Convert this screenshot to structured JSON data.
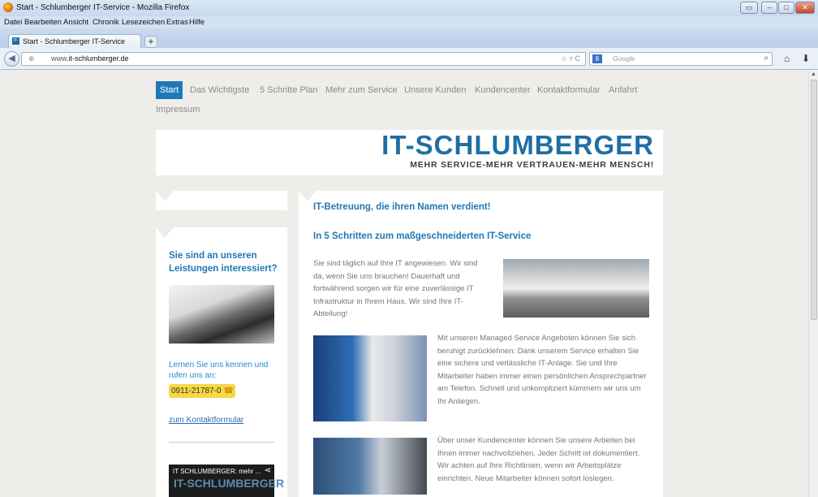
{
  "window": {
    "title": "Start - Schlumberger IT-Service - Mozilla Firefox"
  },
  "menubar": [
    "Datei",
    "Bearbeiten",
    "Ansicht",
    "Chronik",
    "Lesezeichen",
    "Extras",
    "Hilfe"
  ],
  "tab": {
    "title": "Start - Schlumberger IT-Service",
    "favicon": "IT-S"
  },
  "address": {
    "prefix": "www.",
    "host": "it-schlumberger.de"
  },
  "search": {
    "placeholder": "Google",
    "engine": "8"
  },
  "nav": [
    "Start",
    "Das Wichtigste",
    "5 Schritte Plan",
    "Mehr zum Service",
    "Unsere Kunden",
    "Kundencenter",
    "Kontaktformular",
    "Anfahrt",
    "Impressum"
  ],
  "logo": {
    "text": "IT-SCHLUMBERGER",
    "tagline": "MEHR SERVICE-MEHR VERTRAUEN-MEHR MENSCH!"
  },
  "sidebar": {
    "heading": "Sie sind an unseren Leistungen interessiert?",
    "text": "Lernen Sie uns kennen und rufen uns an:",
    "phone": "0911-21787-0",
    "contact_link": "zum Kontaktformular",
    "video_title": "IT SCHLUMBERGER: mehr ...",
    "video_logo": "IT-SCHLUMBERGER"
  },
  "main": {
    "heading1": "IT-Betreuung, die ihren Namen verdient!",
    "heading2": "In 5 Schritten zum maßgeschneiderten IT-Service",
    "para1": "Sie sind täglich auf Ihre IT angewiesen. Wir sind da, wenn Sie uns brauchen! Dauerhaft und fortwährend sorgen wir für eine zuverlässige IT Infrastruktur in Ihrem Haus. Wir sind Ihre IT-Abteilung!",
    "para2": "Mit unseren Managed Service Angeboten können Sie sich beruhigt zurücklehnen: Dank unserem Service erhalten Sie eine sichere und verlässliche IT-Anlage. Sie und Ihre Mitarbeiter haben immer einen persönlichen Ansprechpartner am Telefon. Schnell und unkompliziert kümmern wir uns um Ihr Anliegen.",
    "para3": "Über unser Kundencenter können Sie unsere Arbeiten bei Ihnen immer nachvollziehen. Jeder Schritt ist dokumentiert. Wir achten auf Ihre Richtlinien, wenn wir Arbeitsplätze einrichten. Neue Mitarbeiter können sofort loslegen."
  }
}
